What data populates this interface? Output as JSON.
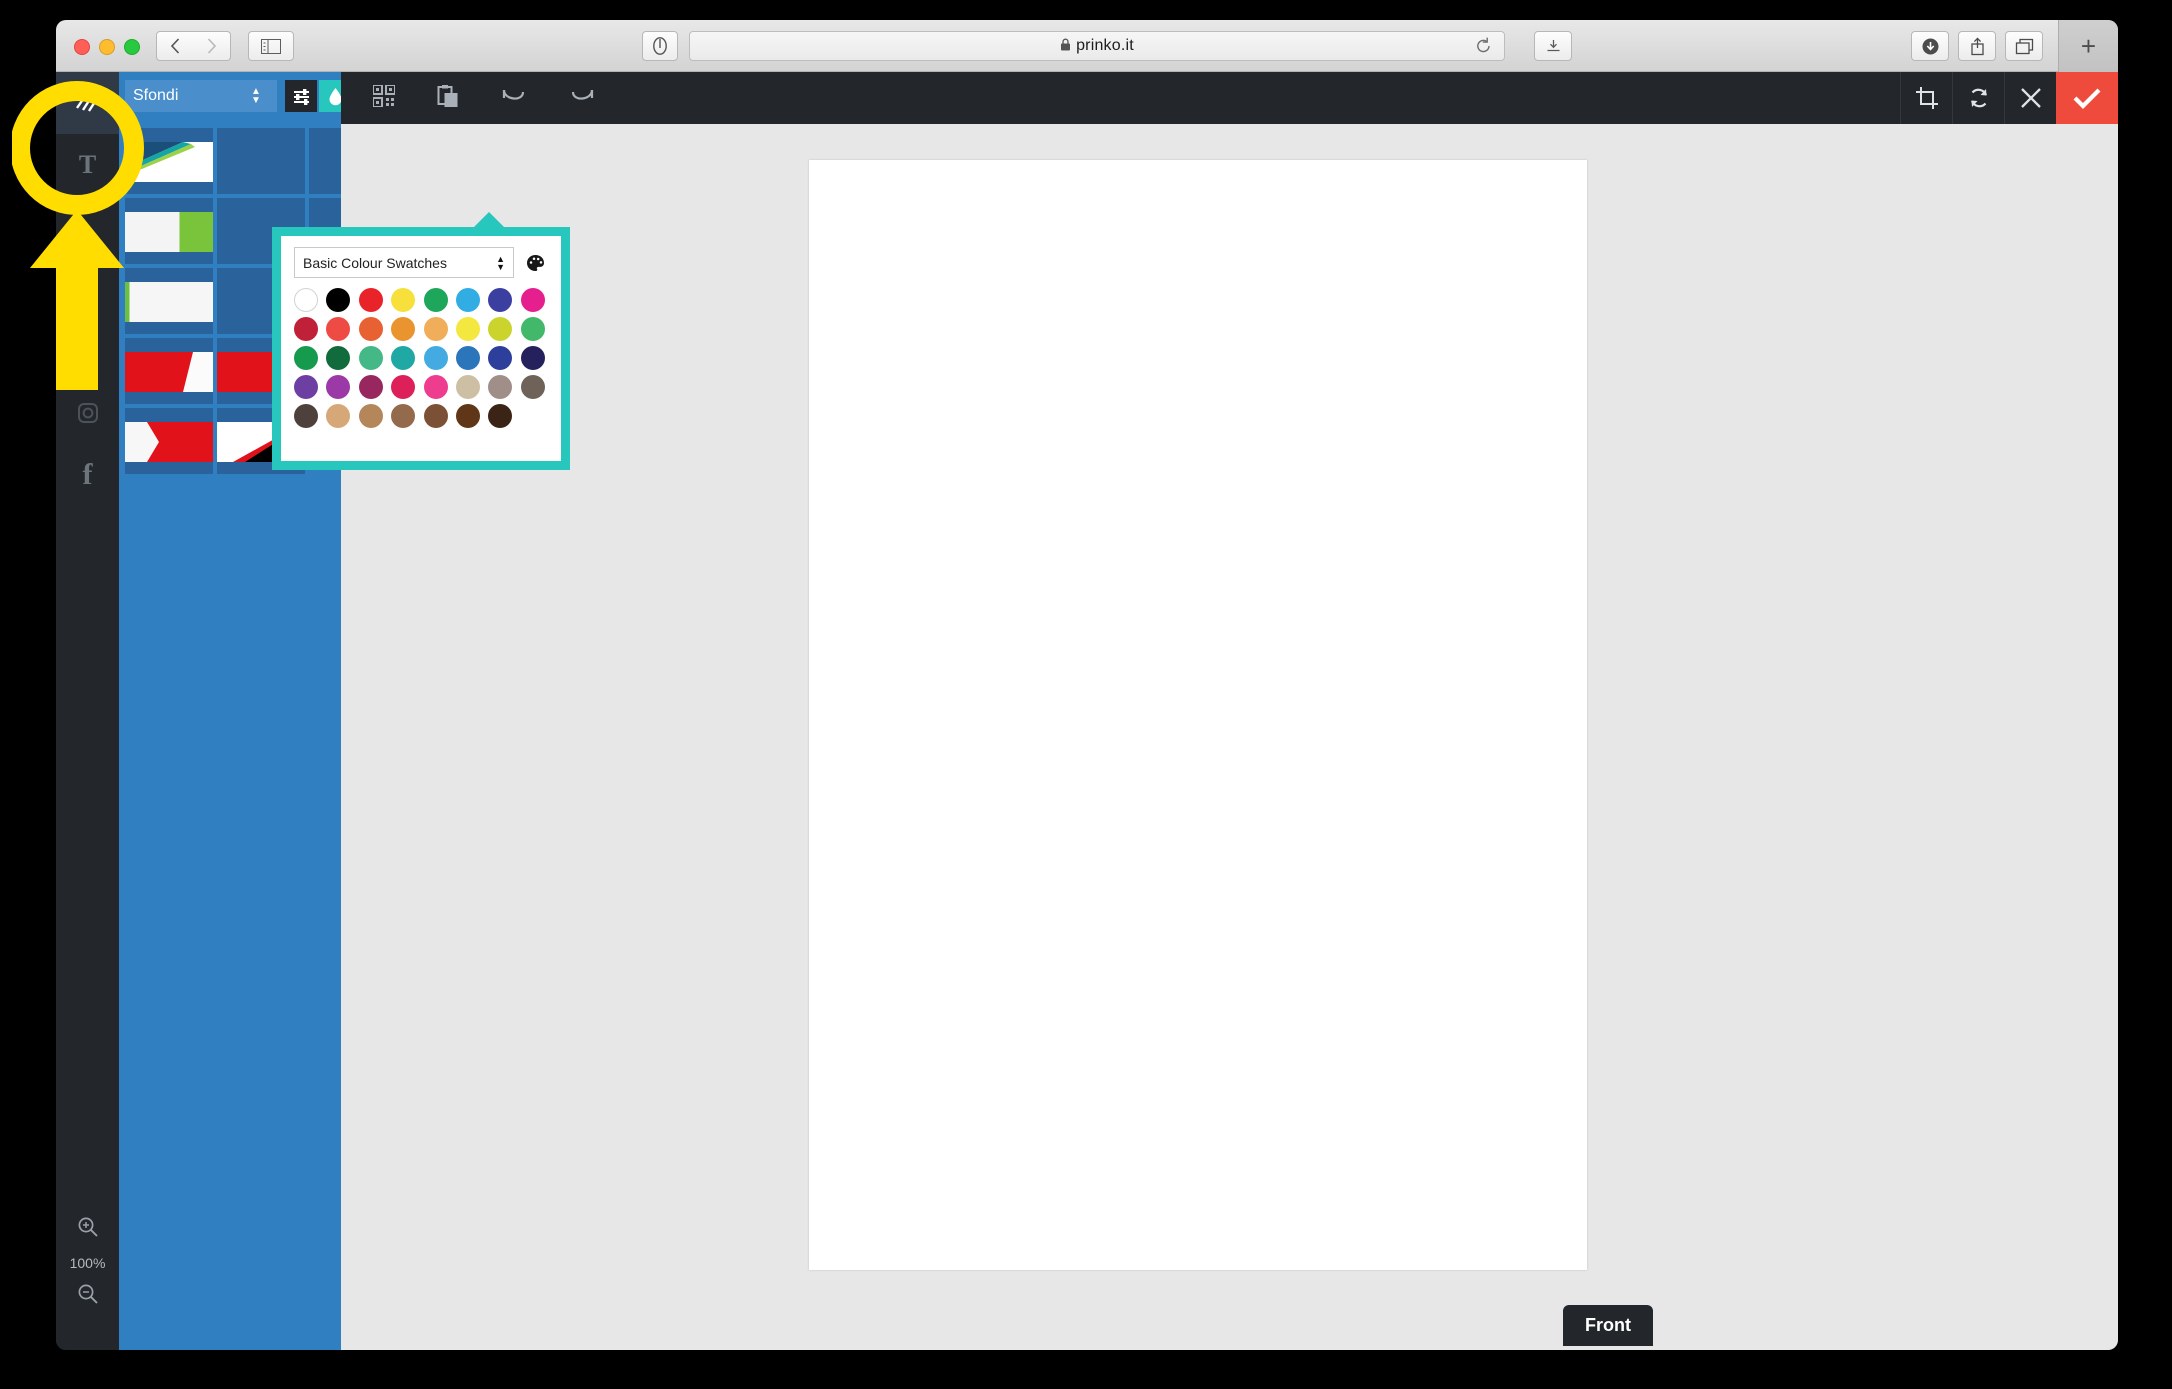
{
  "browser": {
    "url": "prinko.it",
    "lock_icon": "lock-icon",
    "back_icon": "chevron-left-icon",
    "forward_icon": "chevron-right-icon",
    "sidebar_icon": "sidebar-toggle-icon",
    "shield_icon": "privacy-report-icon",
    "reload_icon": "reload-icon",
    "reader_icon": "reader-view-icon",
    "download_icon": "download-icon",
    "share_icon": "share-icon",
    "tabs_icon": "tab-overview-icon",
    "newtab_label": "+"
  },
  "tool_rail": {
    "tools": [
      {
        "name": "pattern-tool",
        "glyph": "pattern",
        "selected": true
      },
      {
        "name": "text-tool",
        "glyph": "T",
        "selected": false
      },
      {
        "name": "upload-tool",
        "glyph": "↥",
        "selected": false
      },
      {
        "name": "instagram-tool",
        "glyph": "◎",
        "selected": false
      },
      {
        "name": "facebook-tool",
        "glyph": "f",
        "selected": false
      }
    ],
    "zoom_in_icon": "zoom-in-icon",
    "zoom_out_icon": "zoom-out-icon",
    "zoom_level": "100%"
  },
  "panel": {
    "category_value": "Sfondi",
    "settings_icon": "sliders-icon",
    "color_icon": "droplet-icon",
    "accent": "#27c7bd",
    "thumbnails": [
      {
        "name": "thumb-teal-swoosh",
        "kind": "teal-swoosh"
      },
      {
        "name": "thumb-blank-1",
        "kind": "blank"
      },
      {
        "name": "thumb-blank-2",
        "kind": "blank"
      },
      {
        "name": "thumb-green-block",
        "kind": "green-block"
      },
      {
        "name": "thumb-blank-3",
        "kind": "blank"
      },
      {
        "name": "thumb-blank-4",
        "kind": "blank"
      },
      {
        "name": "thumb-white-texture",
        "kind": "white-texture"
      },
      {
        "name": "thumb-blank-5",
        "kind": "blank"
      },
      {
        "name": "thumb-blank-6",
        "kind": "blank"
      },
      {
        "name": "thumb-red-white-1",
        "kind": "red-white"
      },
      {
        "name": "thumb-red-white-2",
        "kind": "red-white"
      },
      {
        "name": "thumb-black-red-diag",
        "kind": "black-red-diag"
      },
      {
        "name": "thumb-white-red",
        "kind": "white-red"
      },
      {
        "name": "thumb-white-black-diag",
        "kind": "white-black-diag"
      }
    ]
  },
  "app_toolbar": {
    "qr_icon": "qr-code-icon",
    "paste_icon": "paste-icon",
    "undo_icon": "undo-icon",
    "redo_icon": "redo-icon",
    "crop_icon": "crop-icon",
    "rotate_icon": "rotate-icon",
    "close_icon": "close-icon",
    "confirm_icon": "check-icon",
    "confirm_color": "#ef4b3c"
  },
  "canvas": {
    "side_tab_label": "Front"
  },
  "swatch_popup": {
    "title": "Basic Colour Swatches",
    "palette_icon": "palette-icon",
    "stepper_icon": "stepper-arrows-icon",
    "colors": [
      "#ffffff",
      "#000000",
      "#e8232a",
      "#f7e03c",
      "#1ea65a",
      "#31ade4",
      "#3b3fa0",
      "#e51f8e",
      "#c02139",
      "#ee4b44",
      "#e76132",
      "#ea9430",
      "#f0ad5a",
      "#f4e73f",
      "#cbd42c",
      "#42b86a",
      "#169a4e",
      "#126b3c",
      "#44b887",
      "#20a9a4",
      "#43abe2",
      "#2b76bb",
      "#2e3f9b",
      "#24215c",
      "#6d3fa3",
      "#9b3aa6",
      "#99275f",
      "#dd2059",
      "#ee3c8e",
      "#cdbfa3",
      "#a08f88",
      "#6f6359",
      "#4e403b",
      "#d6a878",
      "#b6865b",
      "#946a4c",
      "#7c5034",
      "#5f3617",
      "#3b2415"
    ]
  },
  "annotation": {
    "name": "yellow-highlight-arrow",
    "color": "#ffdd00",
    "target": "pattern-tool"
  }
}
